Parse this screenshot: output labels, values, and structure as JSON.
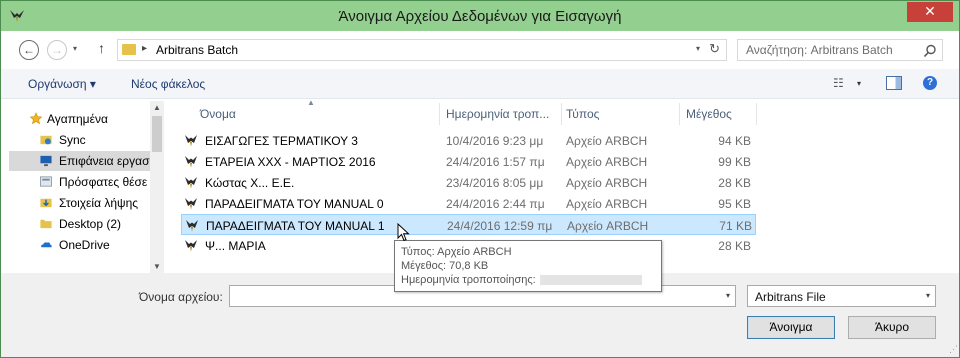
{
  "window": {
    "title": "Άνοιγμα Αρχείου Δεδομένων για Εισαγωγή",
    "close_glyph": "✕",
    "accent": "#93cf8f"
  },
  "address_bar": {
    "back_glyph": "←",
    "forward_glyph": "→",
    "up_glyph": "↑",
    "separator": "▸",
    "path": "Arbitrans Batch",
    "dropdown_glyph": "▾",
    "refresh_glyph": "↻"
  },
  "search": {
    "placeholder": "Αναζήτηση: Arbitrans Batch",
    "icon": "search-icon"
  },
  "toolbar": {
    "organize": "Οργάνωση ▾",
    "new_folder": "Νέος φάκελος",
    "view_glyph": "☷",
    "view_dropdown": "▾",
    "help_glyph": "?"
  },
  "nav_pane": {
    "items": [
      {
        "label": "Αγαπημένα",
        "icon": "star-icon"
      },
      {
        "label": "Sync",
        "icon": "sync-folder-icon"
      },
      {
        "label": "Επιφάνεια εργασ",
        "icon": "desktop-icon"
      },
      {
        "label": "Πρόσφατες θέσε",
        "icon": "recent-places-icon"
      },
      {
        "label": "Στοιχεία λήψης",
        "icon": "downloads-icon"
      },
      {
        "label": "Desktop (2)",
        "icon": "folder-icon"
      },
      {
        "label": "OneDrive",
        "icon": "onedrive-icon"
      }
    ],
    "scroll_up": "▲",
    "scroll_down": "▼"
  },
  "file_list": {
    "columns": [
      "Όνομα",
      "Ημερομηνία τροπ...",
      "Τύπος",
      "Μέγεθος"
    ],
    "sort_glyph": "▲",
    "rows": [
      {
        "name": "ΕΙΣΑΓΩΓΕΣ ΤΕΡΜΑΤΙΚΟΥ 3",
        "date": "10/4/2016 9:23 μμ",
        "type": "Αρχείο ARBCH",
        "size": "94 KB"
      },
      {
        "name": "ΕΤΑΡΕΙΑ ΧΧΧ - ΜΑΡΤΙΟΣ 2016",
        "date": "24/4/2016 1:57 πμ",
        "type": "Αρχείο ARBCH",
        "size": "99 KB"
      },
      {
        "name": "Κώστας Χ... Ε.Ε.",
        "date": "23/4/2016 8:05 μμ",
        "type": "Αρχείο ARBCH",
        "size": "28 KB"
      },
      {
        "name": "ΠΑΡΑΔΕΙΓΜΑΤΑ ΤΟΥ MANUAL 0",
        "date": "24/4/2016 2:44 πμ",
        "type": "Αρχείο ARBCH",
        "size": "95 KB"
      },
      {
        "name": "ΠΑΡΑΔΕΙΓΜΑΤΑ ΤΟΥ MANUAL 1",
        "date": "24/4/2016 12:59 πμ",
        "type": "Αρχείο ARBCH",
        "size": "71 KB"
      },
      {
        "name": "Ψ... ΜΑΡΙΑ",
        "date": "",
        "type": "",
        "size": "28 KB"
      }
    ],
    "selected_index": 4
  },
  "tooltip": {
    "type_line": "Τύπος: Αρχείο ARBCH",
    "size_line": "Μέγεθος: 70,8 KB",
    "modified_label": "Ημερομηνία τροποποίησης:"
  },
  "footer": {
    "filename_label": "Όνομα αρχείου:",
    "filename_value": "",
    "dropdown_glyph": "▾",
    "filter_value": "Arbitrans File",
    "open_button": "Άνοιγμα",
    "cancel_button": "Άκυρο",
    "grip_glyph": "⋰"
  }
}
